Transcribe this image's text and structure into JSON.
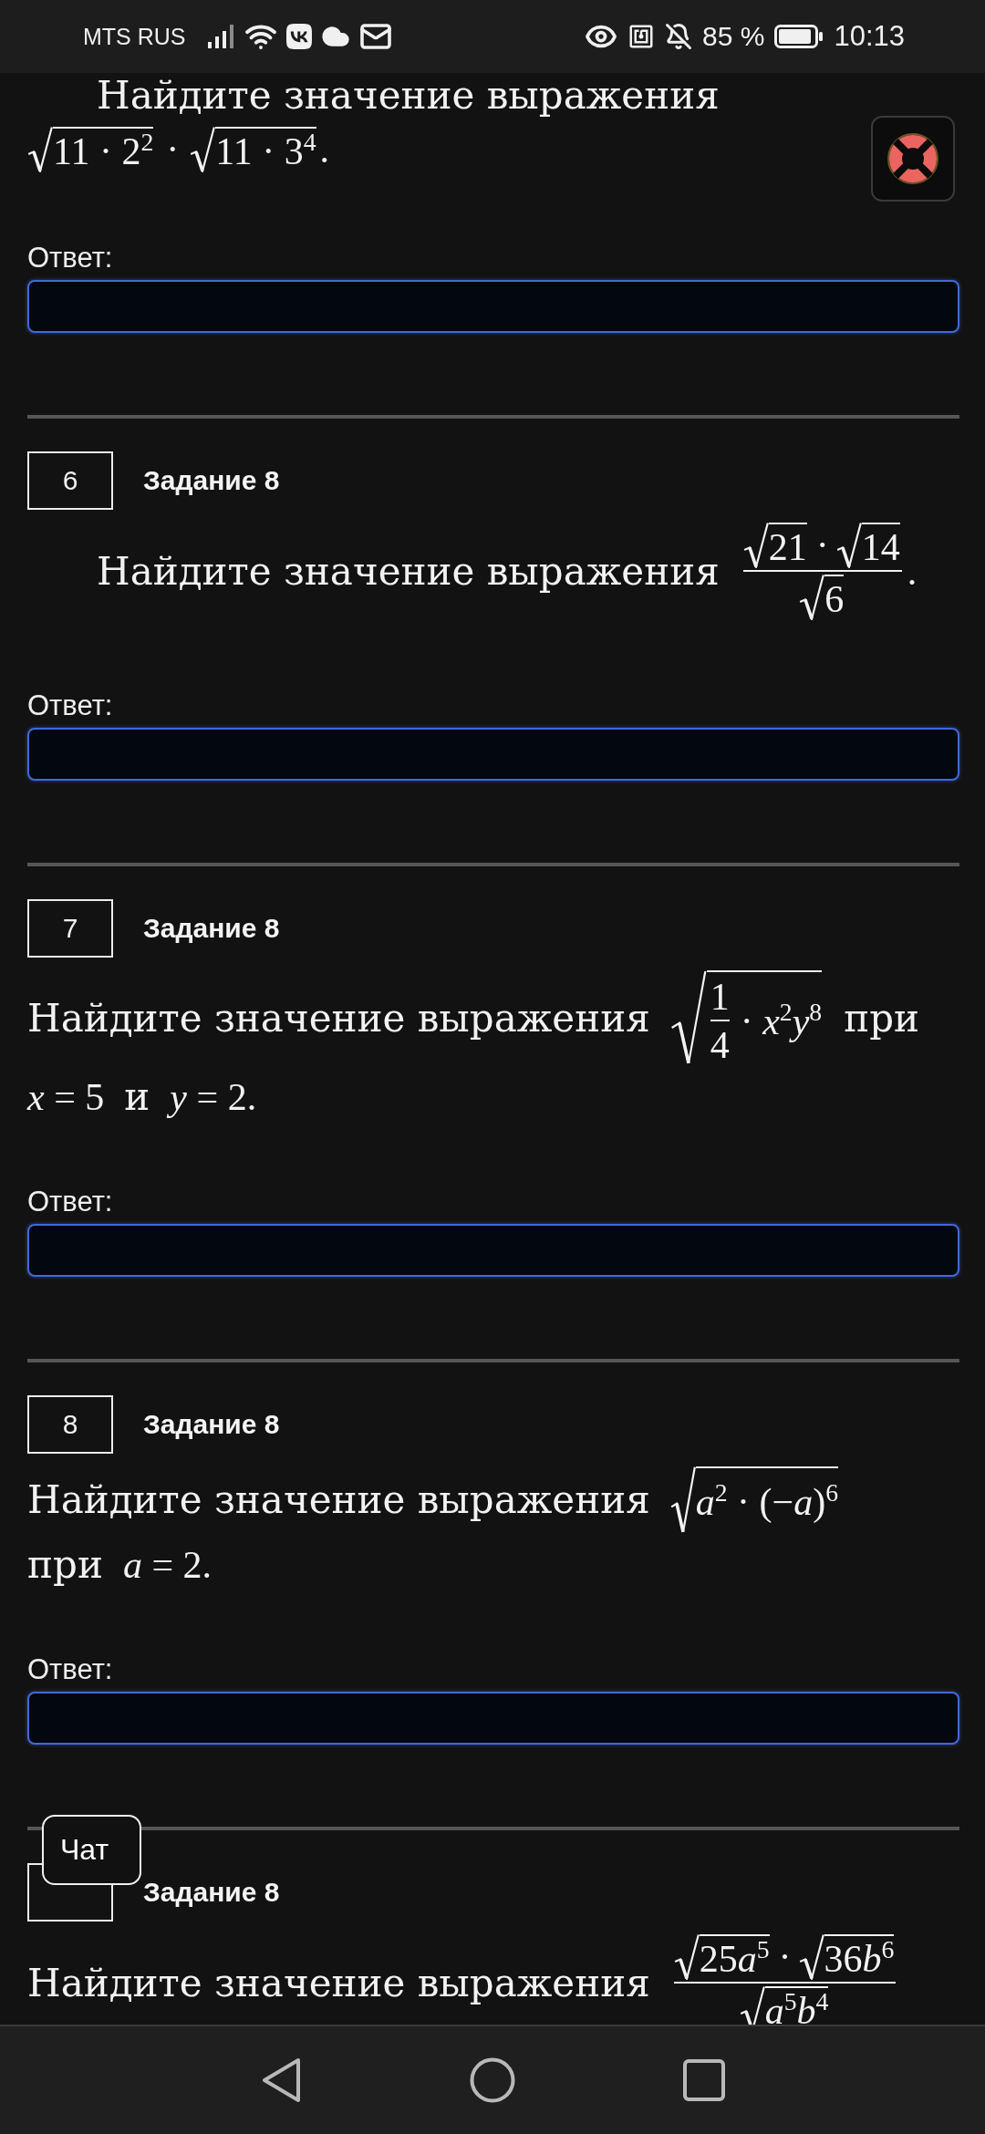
{
  "status_bar": {
    "carrier": "MTS RUS",
    "battery": "85 %",
    "time": "10:13"
  },
  "tasks": [
    {
      "question": {
        "kind": "indented",
        "lines": [
          [
            {
              "kind": "text",
              "text": "Найдите значение выражения"
            }
          ],
          [
            {
              "kind": "sqrt",
              "body": [
                {
                  "kind": "math",
                  "text": "11 · 2$^{2}$"
                }
              ]
            },
            {
              "kind": "math",
              "text": "·"
            },
            {
              "kind": "sqrt",
              "body": [
                {
                  "kind": "math",
                  "text": "11 · 3$^{4}$"
                }
              ]
            },
            {
              "kind": "punct",
              "text": "."
            }
          ]
        ]
      },
      "answer_label": "Ответ:"
    },
    {
      "number": "6",
      "title": "Задание 8",
      "question": {
        "kind": "indented",
        "lines": [
          [
            {
              "kind": "text",
              "text": "Найдите значение выражения"
            },
            {
              "kind": "frac",
              "numerator": [
                {
                  "kind": "sqrt",
                  "body": [
                    {
                      "kind": "math",
                      "text": "21"
                    }
                  ]
                },
                {
                  "kind": "math",
                  "text": "·"
                },
                {
                  "kind": "sqrt",
                  "body": [
                    {
                      "kind": "math",
                      "text": "14"
                    }
                  ]
                }
              ],
              "denominator": [
                {
                  "kind": "sqrt",
                  "body": [
                    {
                      "kind": "math",
                      "text": "6"
                    }
                  ]
                }
              ]
            },
            {
              "kind": "punct",
              "text": "."
            }
          ]
        ]
      },
      "answer_label": "Ответ:"
    },
    {
      "number": "7",
      "title": "Задание 8",
      "question": {
        "kind": "flush",
        "lines": [
          [
            {
              "kind": "text",
              "text": "Найдите значение выражения"
            },
            {
              "kind": "sqrt",
              "body": [
                {
                  "kind": "frac",
                  "numerator": [
                    {
                      "kind": "math",
                      "text": "1"
                    }
                  ],
                  "denominator": [
                    {
                      "kind": "math",
                      "text": "4"
                    }
                  ]
                },
                {
                  "kind": "math",
                  "text": "· x$^{2}$y$^{8}$"
                }
              ]
            },
            {
              "kind": "text",
              "text": "при"
            }
          ],
          [
            {
              "kind": "math",
              "text": "x = 5"
            },
            {
              "kind": "text",
              "text": "и"
            },
            {
              "kind": "math",
              "text": "y = 2."
            }
          ]
        ]
      },
      "answer_label": "Ответ:"
    },
    {
      "number": "8",
      "title": "Задание 8",
      "question": {
        "kind": "flush",
        "lines": [
          [
            {
              "kind": "text",
              "text": "Найдите значение выражения"
            },
            {
              "kind": "sqrt",
              "body": [
                {
                  "kind": "math",
                  "text": "a$^{2}$ · (−a)$^{6}$"
                }
              ]
            }
          ],
          [
            {
              "kind": "text",
              "text": "при"
            },
            {
              "kind": "math",
              "text": "a = 2."
            }
          ]
        ]
      },
      "answer_label": "Ответ:"
    },
    {
      "title": "Задание 8",
      "question": {
        "kind": "flush",
        "lines": [
          [
            {
              "kind": "text",
              "text": "Найдите значение выражения"
            },
            {
              "kind": "frac",
              "numerator": [
                {
                  "kind": "sqrt",
                  "body": [
                    {
                      "kind": "math",
                      "text": "25a$^{5}$"
                    }
                  ]
                },
                {
                  "kind": "math",
                  "text": "·"
                },
                {
                  "kind": "sqrt",
                  "body": [
                    {
                      "kind": "math",
                      "text": "36b$^{6}$"
                    }
                  ]
                }
              ],
              "denominator": [
                {
                  "kind": "sqrt",
                  "body": [
                    {
                      "kind": "math",
                      "text": "a$^{5}$b$^{4}$"
                    }
                  ]
                }
              ]
            }
          ]
        ]
      }
    }
  ],
  "chat_button": {
    "label": "Чат"
  }
}
